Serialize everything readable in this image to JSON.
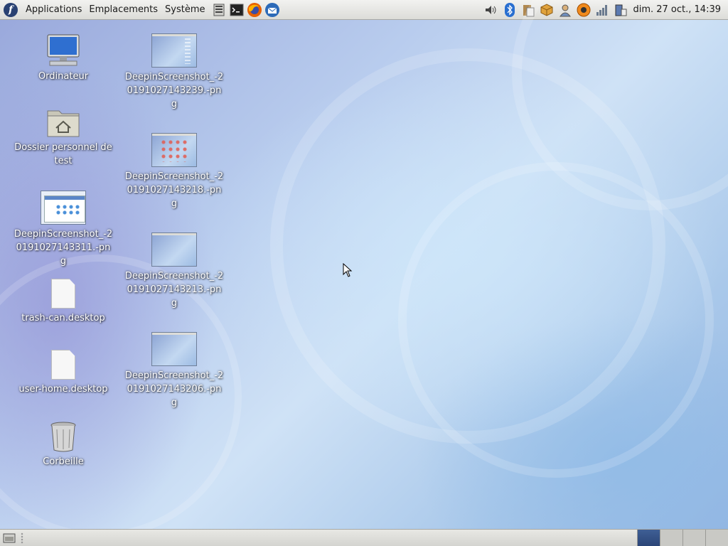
{
  "top_panel": {
    "menus": [
      "Applications",
      "Emplacements",
      "Système"
    ],
    "launchers": [
      "system-monitor-icon",
      "terminal-icon",
      "firefox-icon",
      "thunderbird-icon"
    ],
    "tray": [
      "volume-icon",
      "bluetooth-icon",
      "clipboard-icon",
      "package-updater-icon",
      "network-user-icon",
      "notification-icon",
      "signal-strength-icon",
      "power-icon"
    ],
    "clock": "dim. 27 oct., 14:39"
  },
  "desktop": {
    "icons": [
      {
        "label": "Ordinateur",
        "icon": "computer-icon"
      },
      {
        "label": "Dossier personnel de test",
        "icon": "home-folder-icon"
      },
      {
        "label": "DeepinScreenshot_-20191027143311.-png",
        "icon": "image-thumbnail-icon"
      },
      {
        "label": "trash-can.desktop",
        "icon": "file-icon"
      },
      {
        "label": "user-home.desktop",
        "icon": "file-icon"
      },
      {
        "label": "Corbeille",
        "icon": "trash-icon"
      },
      {
        "label": "DeepinScreenshot_-20191027143239.-png",
        "icon": "image-thumbnail-icon"
      },
      {
        "label": "DeepinScreenshot_-20191027143218.-png",
        "icon": "image-thumbnail-icon"
      },
      {
        "label": "DeepinScreenshot_-20191027143213.-png",
        "icon": "image-thumbnail-icon"
      },
      {
        "label": "DeepinScreenshot_-20191027143206.-png",
        "icon": "image-thumbnail-icon"
      }
    ]
  },
  "bottom_panel": {
    "workspaces": 4,
    "active_workspace": 1
  },
  "colors": {
    "panel": "#dcdcd8",
    "active_workspace": "#2b4577",
    "fedora_blue": "#294172"
  }
}
